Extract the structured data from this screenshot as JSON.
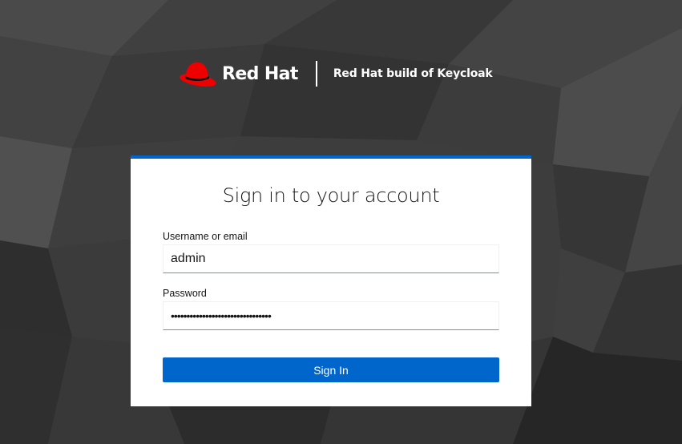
{
  "brand": {
    "name": "Red Hat",
    "product": "Red Hat build of Keycloak",
    "logo_icon": "red-hat-fedora-icon",
    "logo_color": "#ee0000"
  },
  "login": {
    "title": "Sign in to your account",
    "username_label": "Username or email",
    "username_value": "admin",
    "password_label": "Password",
    "password_value": "••••••••••••••••••••••••••••••••",
    "submit_label": "Sign In"
  },
  "colors": {
    "accent": "#0066cc",
    "background": "#3c3c3c",
    "card": "#ffffff"
  }
}
